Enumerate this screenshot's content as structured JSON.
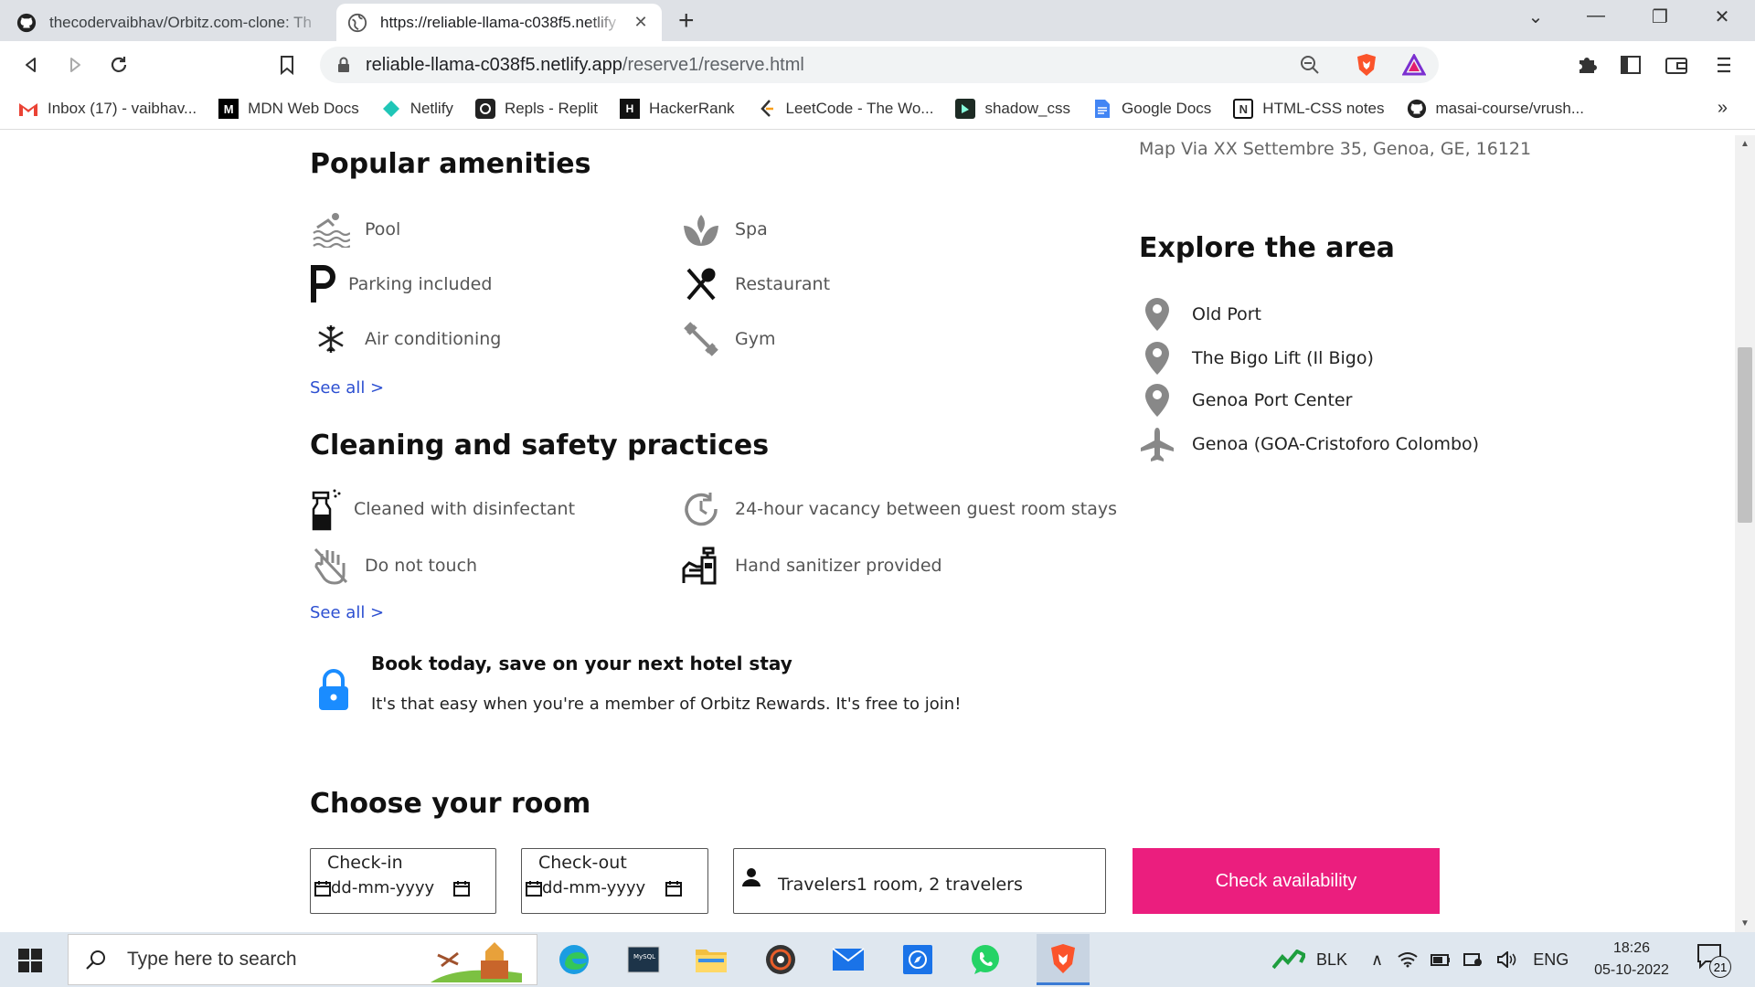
{
  "browser": {
    "tabs": [
      {
        "title": "thecodervaibhav/Orbitz.com-clone: Th",
        "active": false
      },
      {
        "title": "https://reliable-llama-c038f5.netlify",
        "active": true
      }
    ],
    "url_host": "reliable-llama-c038f5.netlify.app",
    "url_path": "/reserve1/reserve.html",
    "bookmarks": [
      {
        "label": "Inbox (17) - vaibhav...",
        "icon": "gmail-icon"
      },
      {
        "label": "MDN Web Docs",
        "icon": "mdn-icon"
      },
      {
        "label": "Netlify",
        "icon": "netlify-icon"
      },
      {
        "label": "Repls - Replit",
        "icon": "replit-icon"
      },
      {
        "label": "HackerRank",
        "icon": "hackerrank-icon"
      },
      {
        "label": "LeetCode - The Wo...",
        "icon": "leetcode-icon"
      },
      {
        "label": "shadow_css",
        "icon": "shadow-css-icon"
      },
      {
        "label": "Google Docs",
        "icon": "google-docs-icon"
      },
      {
        "label": "HTML-CSS notes",
        "icon": "notion-icon"
      },
      {
        "label": "masai-course/vrush...",
        "icon": "github-icon"
      }
    ]
  },
  "page": {
    "address": "Map Via XX Settembre 35, Genoa, GE, 16121",
    "amenities": {
      "heading": "Popular amenities",
      "items": [
        {
          "label": "Pool",
          "icon": "pool-icon"
        },
        {
          "label": "Spa",
          "icon": "spa-icon"
        },
        {
          "label": "Parking included",
          "icon": "parking-icon"
        },
        {
          "label": "Restaurant",
          "icon": "restaurant-icon"
        },
        {
          "label": "Air conditioning",
          "icon": "snowflake-icon"
        },
        {
          "label": "Gym",
          "icon": "dumbbell-icon"
        }
      ],
      "see_all": "See all >"
    },
    "cleaning": {
      "heading": "Cleaning and safety practices",
      "items": [
        {
          "label": "Cleaned with disinfectant",
          "icon": "spray-bottle-icon"
        },
        {
          "label": "24-hour vacancy between guest room stays",
          "icon": "clock-refresh-icon"
        },
        {
          "label": "Do not touch",
          "icon": "no-touch-hand-icon"
        },
        {
          "label": "Hand sanitizer provided",
          "icon": "hand-sanitizer-icon"
        }
      ],
      "see_all": "See all >"
    },
    "explore": {
      "heading": "Explore the area",
      "items": [
        {
          "label": "Old Port",
          "icon": "map-pin-icon"
        },
        {
          "label": "The Bigo Lift (Il Bigo)",
          "icon": "map-pin-icon"
        },
        {
          "label": "Genoa Port Center",
          "icon": "map-pin-icon"
        },
        {
          "label": "Genoa (GOA-Cristoforo Colombo)",
          "icon": "airplane-icon"
        }
      ]
    },
    "promo": {
      "title": "Book today, save on your next hotel stay",
      "text": "It's that easy when you're a member of Orbitz Rewards. It's free to join!"
    },
    "room": {
      "heading": "Choose your room",
      "checkin_label": "Check-in",
      "checkin_placeholder": "dd-mm-yyyy",
      "checkout_label": "Check-out",
      "checkout_placeholder": "dd-mm-yyyy",
      "travelers": "Travelers1 room, 2 travelers",
      "button": "Check availability"
    },
    "accent_color": "#eb1e7e",
    "link_color": "#2c4fd1"
  },
  "taskbar": {
    "search_placeholder": "Type here to search",
    "stock_label": "BLK",
    "language": "ENG",
    "time": "18:26",
    "date": "05-10-2022",
    "notifications": "21"
  }
}
